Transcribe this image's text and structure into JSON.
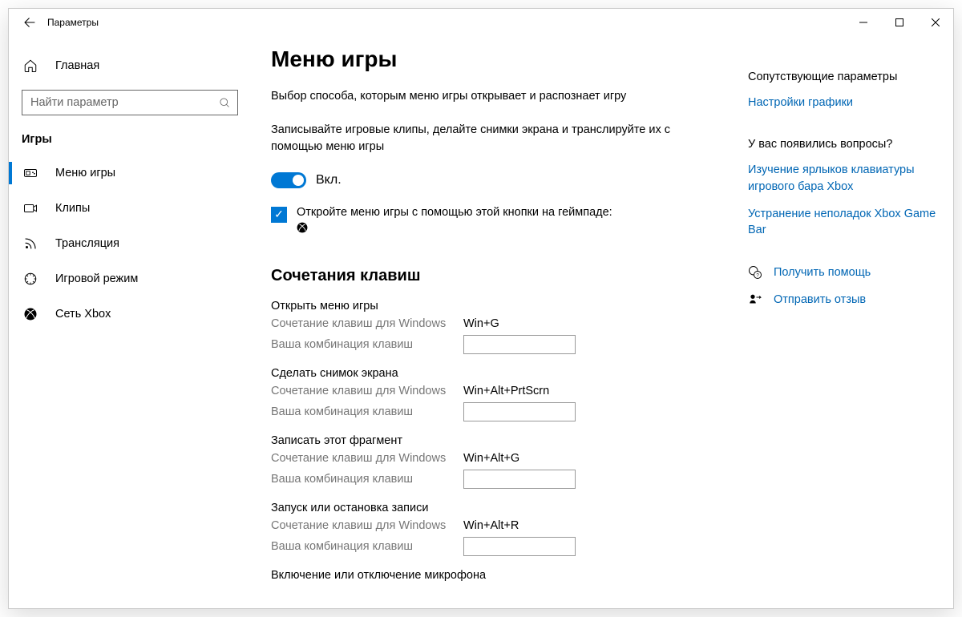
{
  "title": "Параметры",
  "sidebar": {
    "home": "Главная",
    "search_placeholder": "Найти параметр",
    "section": "Игры",
    "items": [
      {
        "label": "Меню игры"
      },
      {
        "label": "Клипы"
      },
      {
        "label": "Трансляция"
      },
      {
        "label": "Игровой режим"
      },
      {
        "label": "Сеть Xbox"
      }
    ]
  },
  "main": {
    "heading": "Меню игры",
    "desc1": "Выбор способа, которым меню игры открывает и распознает игру",
    "desc2": "Записывайте игровые клипы, делайте снимки экрана и транслируйте их с помощью меню игры",
    "toggle_label": "Вкл.",
    "check_label": "Откройте меню игры с помощью этой кнопки на геймпаде:",
    "shortcuts_heading": "Сочетания клавиш",
    "win_label": "Сочетание клавиш для Windows",
    "user_label": "Ваша комбинация клавиш",
    "groups": [
      {
        "title": "Открыть меню игры",
        "win": "Win+G"
      },
      {
        "title": "Сделать снимок экрана",
        "win": "Win+Alt+PrtScrn"
      },
      {
        "title": "Записать этот фрагмент",
        "win": "Win+Alt+G"
      },
      {
        "title": "Запуск или остановка записи",
        "win": "Win+Alt+R"
      }
    ],
    "final_title": "Включение или отключение микрофона"
  },
  "right": {
    "related_h": "Сопутствующие параметры",
    "related_link": "Настройки графики",
    "questions_h": "У вас появились вопросы?",
    "q_link1": "Изучение ярлыков клавиатуры игрового бара Xbox",
    "q_link2": "Устранение неполадок Xbox Game Bar",
    "help_link": "Получить помощь",
    "feedback_link": "Отправить отзыв"
  }
}
